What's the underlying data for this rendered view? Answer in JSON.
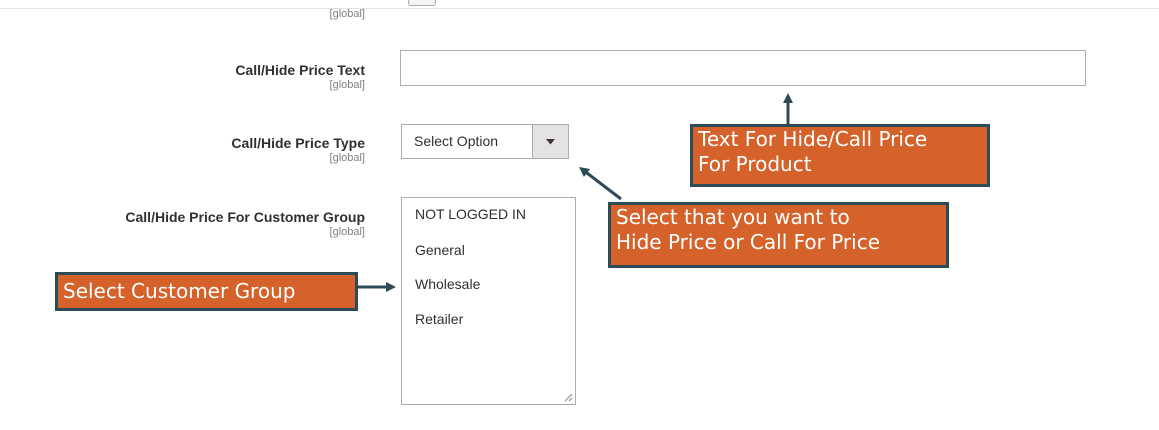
{
  "scope_label": "[global]",
  "fields": {
    "price_text": {
      "label": "Call/Hide Price Text",
      "scope": "[global]",
      "value": "",
      "placeholder": ""
    },
    "price_type": {
      "label": "Call/Hide Price Type",
      "scope": "[global]",
      "selected": "Select Option"
    },
    "customer_group": {
      "label": "Call/Hide Price For Customer Group",
      "scope": "[global]",
      "options": [
        "NOT LOGGED IN",
        "General",
        "Wholesale",
        "Retailer"
      ]
    }
  },
  "callouts": {
    "text_field": [
      "Text For Hide/Call Price",
      "For Product"
    ],
    "price_type": [
      "Select that you want to",
      "Hide Price or Call For Price"
    ],
    "customer_group": [
      "Select Customer Group"
    ]
  },
  "colors": {
    "callout_fill": "#d5622a",
    "callout_border": "#2d4b55",
    "arrow": "#2d4b55"
  },
  "icons": {
    "select_arrow": "caret-down-icon",
    "resize": "resize-handle-icon"
  }
}
